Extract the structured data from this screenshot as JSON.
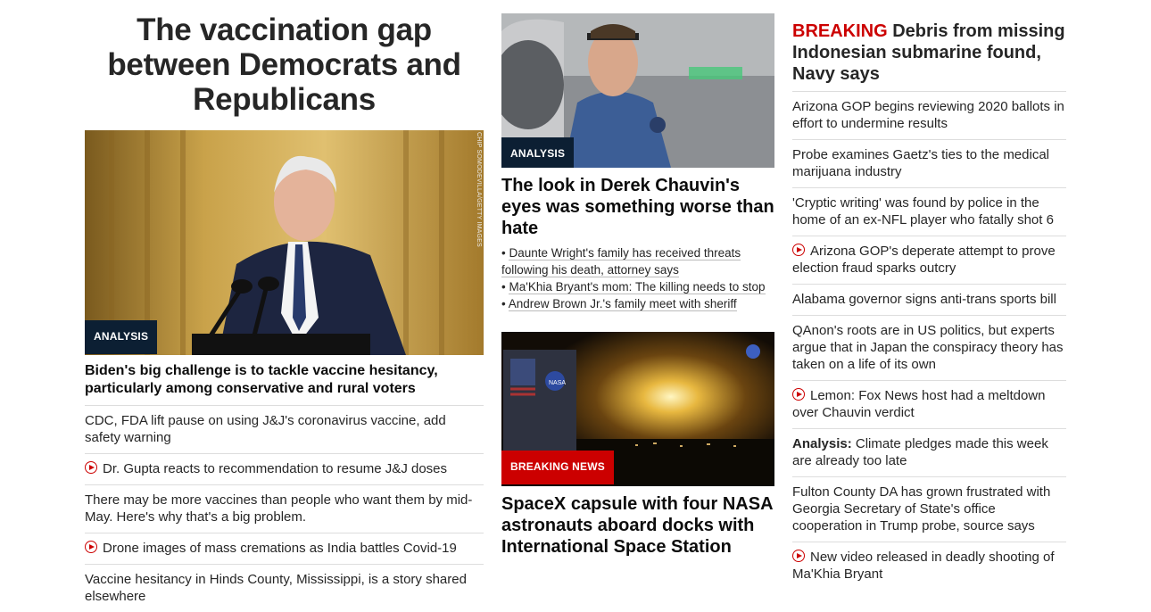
{
  "col1": {
    "title": "The vaccination gap between Democrats and Republicans",
    "hero": {
      "label": "ANALYSIS",
      "photo_credit": "CHIP SOMODEVILLA/GETTY IMAGES"
    },
    "headline": "Biden's big challenge is to tackle vaccine hesitancy, particularly among conservative and rural voters",
    "items": [
      {
        "text": "CDC, FDA lift pause on using J&J's coronavirus vaccine, add safety warning",
        "video": false
      },
      {
        "text": "Dr. Gupta reacts to recommendation to resume J&J doses",
        "video": true
      },
      {
        "text": "There may be more vaccines than people who want them by mid-May. Here's why that's a big problem.",
        "video": false
      },
      {
        "text": "Drone images of mass cremations as India battles Covid-19",
        "video": true
      },
      {
        "text": "Vaccine hesitancy in Hinds County, Mississippi, is a story shared elsewhere",
        "video": false
      }
    ]
  },
  "col2": {
    "story1": {
      "label": "ANALYSIS",
      "headline": "The look in Derek Chauvin's eyes was something worse than hate",
      "bullets": [
        "Daunte Wright's family has received threats following his death, attorney says",
        "Ma'Khia Bryant's mom: The killing needs to stop",
        "Andrew Brown Jr.'s family meet with sheriff"
      ]
    },
    "story2": {
      "label": "BREAKING NEWS",
      "headline": "SpaceX capsule with four NASA astronauts aboard docks with International Space Station"
    }
  },
  "col3": {
    "breaking_kicker": "BREAKING",
    "breaking_headline": "Debris from missing Indonesian submarine found, Navy says",
    "items": [
      {
        "text": "Arizona GOP begins reviewing 2020 ballots in effort to undermine results",
        "video": false
      },
      {
        "text": "Probe examines Gaetz's ties to the medical marijuana industry",
        "video": false
      },
      {
        "text": "'Cryptic writing' was found by police in the home of an ex-NFL player who fatally shot 6",
        "video": false
      },
      {
        "text": "Arizona GOP's deperate attempt to prove election fraud sparks outcry",
        "video": true
      },
      {
        "text": "Alabama governor signs anti-trans sports bill",
        "video": false
      },
      {
        "text": "QAnon's roots are in US politics, but experts argue that in Japan the conspiracy theory has taken on a life of its own",
        "video": false
      },
      {
        "text": "Lemon: Fox News host had a meltdown over Chauvin verdict",
        "video": true
      },
      {
        "prefix": "Analysis:",
        "text": "Climate pledges made this week are already too late",
        "video": false
      },
      {
        "text": "Fulton County DA has grown frustrated with Georgia Secretary of State's office cooperation in Trump probe, source says",
        "video": false
      },
      {
        "text": "New video released in deadly shooting of Ma'Khia Bryant",
        "video": true
      }
    ]
  },
  "colors": {
    "accent_red": "#cc0000",
    "analysis_navy": "#0c1f33",
    "divider": "#dddddd"
  }
}
